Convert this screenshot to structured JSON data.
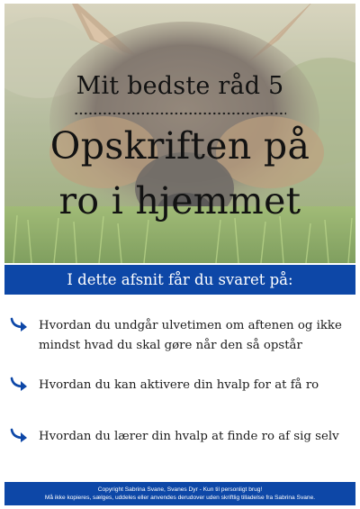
{
  "hero": {
    "subtitle": "Mit bedste råd 5",
    "title_line1": "Opskriften på",
    "title_line2": "ro i hjemmet",
    "image_subject": "puppy-lying-in-grass"
  },
  "band": {
    "text": "I dette afsnit får du svaret på:"
  },
  "bullets": {
    "icon": "curved-arrow-icon",
    "accent_color": "#0d47a7",
    "items": [
      {
        "text": "Hvordan du undgår ulvetimen om aftenen og ikke mindst hvad du skal gøre når den så opstår"
      },
      {
        "text": "Hvordan du kan aktivere din hvalp for at få ro"
      },
      {
        "text": "Hvordan du lærer din hvalp at finde ro af sig selv"
      }
    ]
  },
  "footer": {
    "line1": "Copyright Sabrina Svane, Svanes Dyr - Kun til personligt brug!",
    "line2": "Må ikke kopieres, sælges, uddeles eller anvendes derudover uden skriftlig tilladelse fra Sabrina Svane."
  },
  "colors": {
    "brand_blue": "#0d47a7",
    "text_dark": "#121212"
  }
}
